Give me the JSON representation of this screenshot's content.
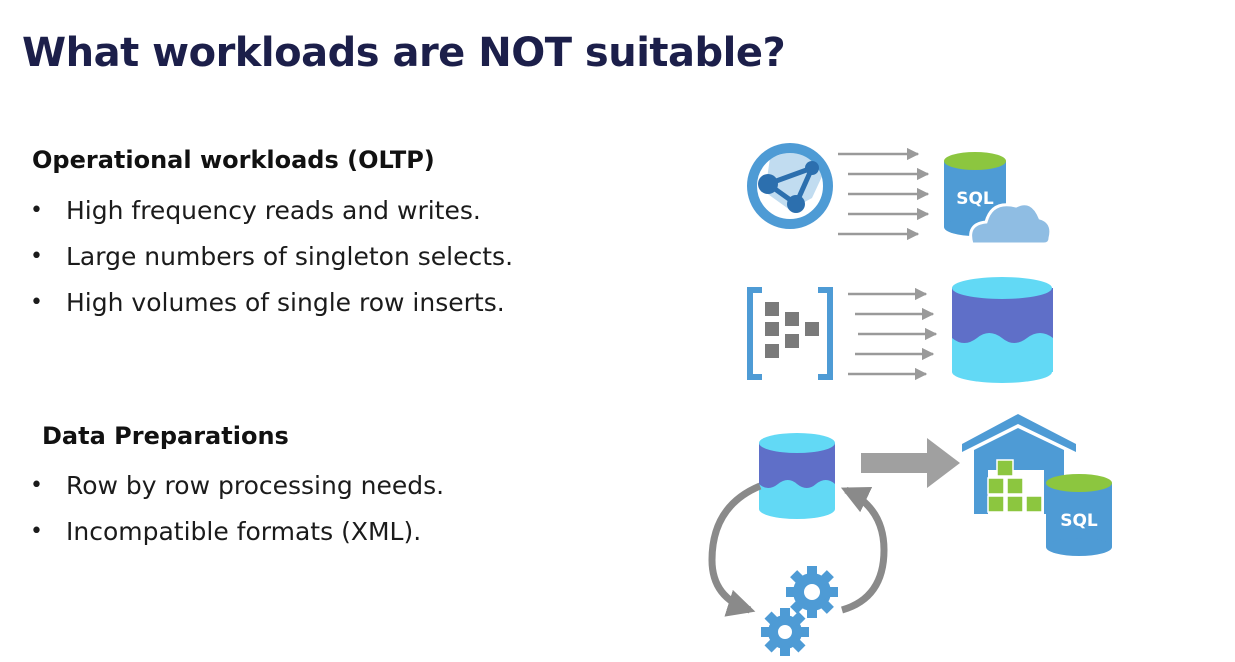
{
  "slide": {
    "title": "What workloads are NOT suitable?"
  },
  "sections": [
    {
      "heading": "Operational workloads (OLTP)",
      "bullets": [
        "High frequency reads and writes.",
        "Large numbers of singleton selects.",
        "High volumes of single row inserts."
      ]
    },
    {
      "heading": "Data Preparations",
      "bullets": [
        "Row by row processing needs.",
        "Incompatible formats (XML)."
      ]
    }
  ],
  "graphic": {
    "sql_label": "SQL",
    "colors": {
      "dark_blue": "#2c6fae",
      "azure_blue": "#4e9bd5",
      "light_cyan": "#62d9f5",
      "db_band": "#5f6fc8",
      "green": "#8cc63f",
      "grey": "#a0a0a0",
      "cloud": "#8fbde3"
    },
    "icons": [
      "network-globe-icon",
      "sql-database-icon",
      "cloud-icon",
      "stream-analytics-icon",
      "database-icon",
      "etl-database-icon",
      "gears-icon",
      "warehouse-icon",
      "sql-database-icon"
    ]
  }
}
